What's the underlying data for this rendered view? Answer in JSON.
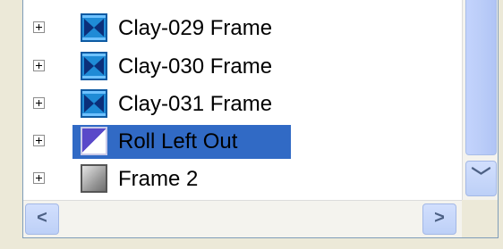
{
  "tree": {
    "items": [
      {
        "label": "Clay-029 Frame",
        "icon": "clay-frame-icon",
        "selected": false
      },
      {
        "label": "Clay-030 Frame",
        "icon": "clay-frame-icon",
        "selected": false
      },
      {
        "label": "Clay-031 Frame",
        "icon": "clay-frame-icon",
        "selected": false
      },
      {
        "label": "Roll Left Out",
        "icon": "transition-icon",
        "selected": true
      },
      {
        "label": "Frame 2",
        "icon": "frame-icon",
        "selected": false
      }
    ]
  },
  "scrollbars": {
    "down_glyph": "﹀",
    "left_glyph": "<",
    "right_glyph": ">"
  },
  "colors": {
    "selection": "#316ac5",
    "scroll_thumb": "#c3d3fd"
  }
}
